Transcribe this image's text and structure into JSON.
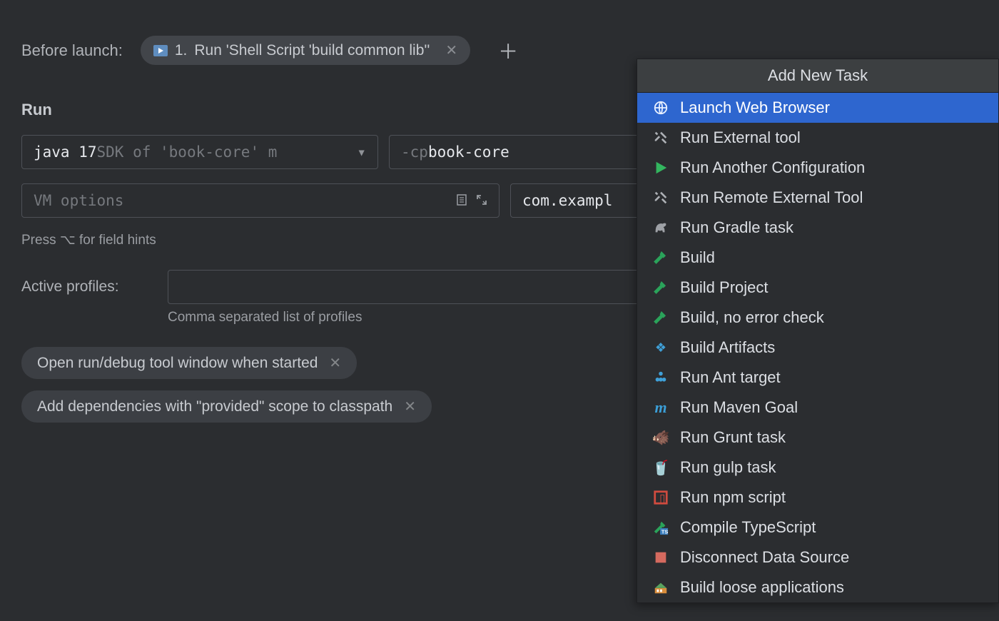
{
  "before_launch": {
    "label": "Before launch:",
    "task_prefix": "1. ",
    "task_label": "Run 'Shell Script 'build common lib''"
  },
  "run": {
    "heading": "Run",
    "sdk": {
      "bright": "java 17",
      "dim": " SDK of 'book-core' m"
    },
    "cp": {
      "dim": "-cp ",
      "bright": "book-core"
    },
    "vm_placeholder": "VM options",
    "main_class": "com.exampl",
    "hint": "Press ⌥ for field hints",
    "profiles_label": "Active profiles:",
    "profiles_hint": "Comma separated list of profiles",
    "chip_open": "Open run/debug tool window when started",
    "chip_deps": "Add dependencies with \"provided\" scope to classpath"
  },
  "popup": {
    "title": "Add New Task",
    "items": [
      {
        "label": "Launch Web Browser",
        "icon": "globe",
        "selected": true
      },
      {
        "label": "Run External tool",
        "icon": "tools"
      },
      {
        "label": "Run Another Configuration",
        "icon": "play"
      },
      {
        "label": "Run Remote External Tool",
        "icon": "tools"
      },
      {
        "label": "Run Gradle task",
        "icon": "gradle"
      },
      {
        "label": "Build",
        "icon": "hammer"
      },
      {
        "label": "Build Project",
        "icon": "hammer"
      },
      {
        "label": "Build, no error check",
        "icon": "hammer"
      },
      {
        "label": "Build Artifacts",
        "icon": "diamond"
      },
      {
        "label": "Run Ant target",
        "icon": "dots"
      },
      {
        "label": "Run Maven Goal",
        "icon": "maven"
      },
      {
        "label": "Run Grunt task",
        "icon": "grunt"
      },
      {
        "label": "Run gulp task",
        "icon": "gulp"
      },
      {
        "label": "Run npm script",
        "icon": "npm"
      },
      {
        "label": "Compile TypeScript",
        "icon": "ts"
      },
      {
        "label": "Disconnect Data Source",
        "icon": "datasource"
      },
      {
        "label": "Build loose applications",
        "icon": "openliberty"
      }
    ]
  }
}
